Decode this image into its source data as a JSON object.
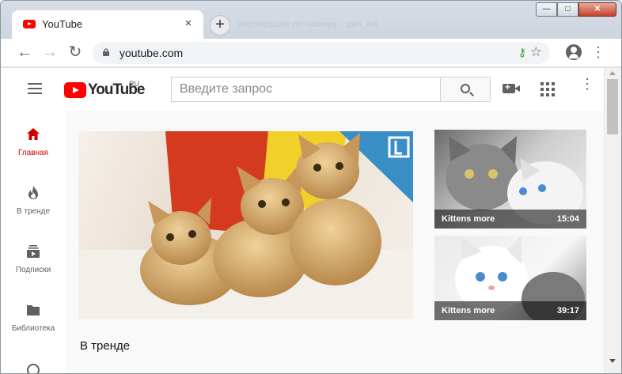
{
  "browser": {
    "tab_title": "YouTube",
    "tab_close": "×",
    "new_tab": "+",
    "ghost_text": "корпорация по номеру · дач_ой",
    "url": "youtube.com",
    "window_controls": {
      "minimize": "—",
      "maximize": "□",
      "close": "✕"
    },
    "nav": {
      "back": "←",
      "forward": "→",
      "reload": "↻"
    },
    "omnibox_icons": {
      "key": "⚷",
      "star": "☆"
    },
    "menu": "⋮"
  },
  "youtube": {
    "logo_text": "YouTube",
    "region": "RU",
    "search_placeholder": "Введите запрос",
    "more": "⋮",
    "guide": [
      {
        "label": "Главная",
        "icon": "home-icon"
      },
      {
        "label": "В тренде",
        "icon": "fire-icon"
      },
      {
        "label": "Подписки",
        "icon": "subscriptions-icon"
      },
      {
        "label": "Библиотека",
        "icon": "folder-icon"
      }
    ],
    "side_videos": [
      {
        "title": "Kittens more",
        "duration": "15:04"
      },
      {
        "title": "Kittens more",
        "duration": "39:17"
      }
    ],
    "trending_heading": "В тренде",
    "colors": {
      "brand_red": "#ff0000",
      "active_red": "#cc0000"
    }
  }
}
